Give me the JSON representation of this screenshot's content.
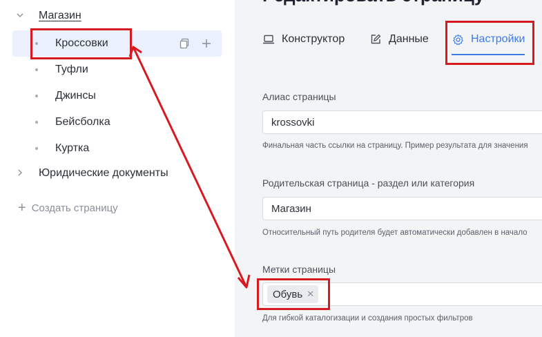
{
  "tree": {
    "root_shop": {
      "label": "Магазин",
      "chevron": "chevron-down-icon"
    },
    "children": [
      {
        "label": "Кроссовки",
        "selected": true
      },
      {
        "label": "Туфли"
      },
      {
        "label": "Джинсы"
      },
      {
        "label": "Бейсболка"
      },
      {
        "label": "Куртка"
      }
    ],
    "root_legal": {
      "label": "Юридические документы",
      "chevron": "chevron-right-icon"
    },
    "create_label": "Создать страницу",
    "row_actions": [
      "copy-icon",
      "plus-icon"
    ]
  },
  "main": {
    "page_title": "Редактировать страницу",
    "tabs": [
      {
        "label": "Конструктор",
        "icon": "laptop-icon"
      },
      {
        "label": "Данные",
        "icon": "edit-icon"
      },
      {
        "label": "Настройки",
        "icon": "gear-icon",
        "active": true
      }
    ],
    "alias": {
      "label": "Алиас страницы",
      "value": "krossovki",
      "hint": "Финальная часть ссылки на страницу. Пример результата для значения"
    },
    "parent": {
      "label": "Родительская страница - раздел или категория",
      "value": "Магазин",
      "hint": "Относительный путь родителя будет автоматически добавлен в начало"
    },
    "tags": {
      "label": "Метки страницы",
      "items": [
        "Обувь"
      ],
      "hint": "Для гибкой каталогизации и создания простых фильтров"
    }
  },
  "colors": {
    "accent": "#3c7be6",
    "annotation": "#d71920",
    "selected_row": "#eaf1fc"
  }
}
